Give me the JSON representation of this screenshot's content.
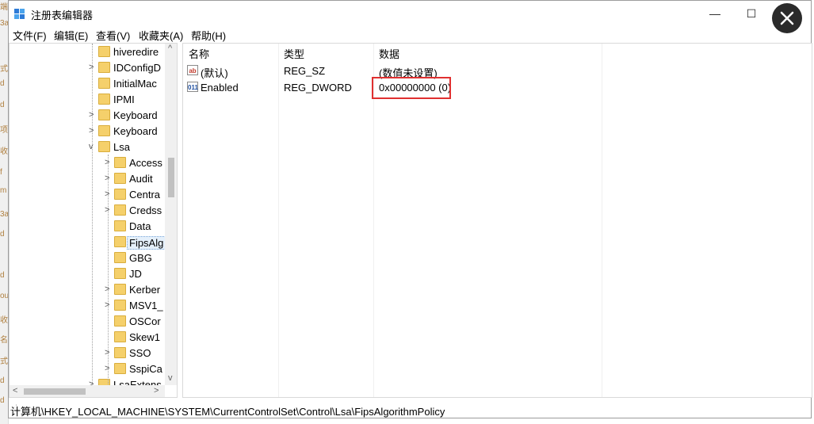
{
  "window": {
    "title": "注册表编辑器",
    "minimize": "—",
    "maximize": "☐",
    "close": "✕"
  },
  "menu": [
    "文件(F)",
    "编辑(E)",
    "查看(V)",
    "收藏夹(A)",
    "帮助(H)"
  ],
  "tree": [
    {
      "label": "hiveredire",
      "level": 1,
      "expander": ""
    },
    {
      "label": "IDConfigD",
      "level": 1,
      "expander": ">"
    },
    {
      "label": "InitialMac",
      "level": 1,
      "expander": ""
    },
    {
      "label": "IPMI",
      "level": 1,
      "expander": ""
    },
    {
      "label": "Keyboard",
      "level": 1,
      "expander": ">"
    },
    {
      "label": "Keyboard",
      "level": 1,
      "expander": ">"
    },
    {
      "label": "Lsa",
      "level": 1,
      "expander": "v"
    },
    {
      "label": "Access",
      "level": 2,
      "expander": ">"
    },
    {
      "label": "Audit",
      "level": 2,
      "expander": ">"
    },
    {
      "label": "Centra",
      "level": 2,
      "expander": ">"
    },
    {
      "label": "Credss",
      "level": 2,
      "expander": ">"
    },
    {
      "label": "Data",
      "level": 2,
      "expander": ""
    },
    {
      "label": "FipsAlg",
      "level": 2,
      "expander": "",
      "selected": true
    },
    {
      "label": "GBG",
      "level": 2,
      "expander": ""
    },
    {
      "label": "JD",
      "level": 2,
      "expander": ""
    },
    {
      "label": "Kerber",
      "level": 2,
      "expander": ">"
    },
    {
      "label": "MSV1_",
      "level": 2,
      "expander": ">"
    },
    {
      "label": "OSCor",
      "level": 2,
      "expander": ""
    },
    {
      "label": "Skew1",
      "level": 2,
      "expander": ""
    },
    {
      "label": "SSO",
      "level": 2,
      "expander": ">"
    },
    {
      "label": "SspiCa",
      "level": 2,
      "expander": ">"
    },
    {
      "label": "LsaExtens",
      "level": 1,
      "expander": ">"
    }
  ],
  "columns": {
    "name": "名称",
    "type": "类型",
    "data": "数据"
  },
  "values": [
    {
      "icon": "string-value-icon",
      "icon_text": "ab",
      "name": "(默认)",
      "type": "REG_SZ",
      "data": "(数值未设置)"
    },
    {
      "icon": "binary-value-icon",
      "icon_text": "011",
      "name": "Enabled",
      "type": "REG_DWORD",
      "data": "0x00000000 (0)"
    }
  ],
  "status": {
    "path": "计算机\\HKEY_LOCAL_MACHINE\\SYSTEM\\CurrentControlSet\\Control\\Lsa\\FipsAlgorithmPolicy"
  },
  "background_fragments": [
    "端",
    "3a",
    "式",
    "d",
    "d",
    "项",
    "收",
    "f",
    "m",
    "3a",
    "d",
    "d",
    "ou",
    "收",
    "名",
    "式",
    "d",
    "d"
  ],
  "colors": {
    "highlight_border": "#e03030",
    "folder": "#f5d06b",
    "selection": "#e5f0fb"
  }
}
